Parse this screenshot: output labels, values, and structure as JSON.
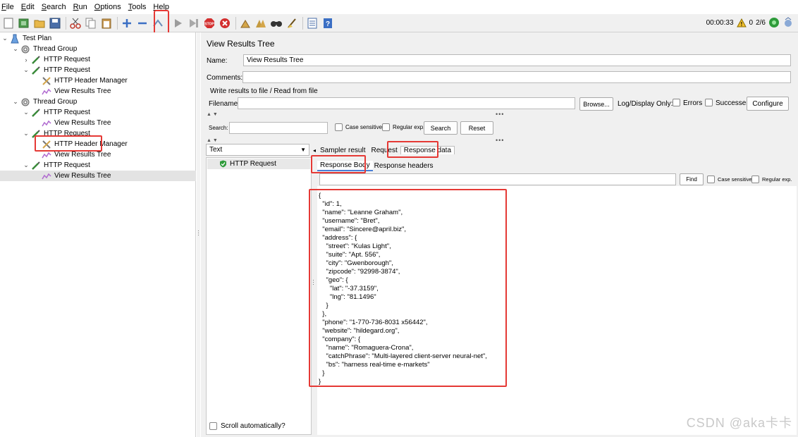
{
  "menu": [
    "File",
    "Edit",
    "Search",
    "Run",
    "Options",
    "Tools",
    "Help"
  ],
  "menu_underline": [
    "F",
    "E",
    "S",
    "R",
    "O",
    "T",
    "H"
  ],
  "status": {
    "timer": "00:00:33",
    "warnings": "0",
    "threads": "2/6"
  },
  "tree": [
    {
      "label": "Test Plan",
      "icon": "test-plan-icon",
      "indent": 0,
      "chev": "⌄"
    },
    {
      "label": "Thread Group",
      "icon": "gear-icon",
      "indent": 1,
      "chev": "⌄"
    },
    {
      "label": "HTTP Request",
      "icon": "pipette-icon",
      "indent": 2,
      "chev": "›"
    },
    {
      "label": "HTTP Request",
      "icon": "pipette-icon",
      "indent": 2,
      "chev": "⌄"
    },
    {
      "label": "HTTP Header Manager",
      "icon": "tools-icon",
      "indent": 3,
      "chev": ""
    },
    {
      "label": "View Results Tree",
      "icon": "chart-icon",
      "indent": 3,
      "chev": ""
    },
    {
      "label": "Thread Group",
      "icon": "gear-icon",
      "indent": 1,
      "chev": "⌄"
    },
    {
      "label": "HTTP Request",
      "icon": "pipette-icon",
      "indent": 2,
      "chev": "⌄"
    },
    {
      "label": "View Results Tree",
      "icon": "chart-icon",
      "indent": 3,
      "chev": ""
    },
    {
      "label": "HTTP Request",
      "icon": "pipette-icon",
      "indent": 2,
      "chev": "⌄"
    },
    {
      "label": "HTTP Header Manager",
      "icon": "tools-icon",
      "indent": 3,
      "chev": ""
    },
    {
      "label": "View Results Tree",
      "icon": "chart-icon",
      "indent": 3,
      "chev": ""
    },
    {
      "label": "HTTP Request",
      "icon": "pipette-icon",
      "indent": 2,
      "chev": "⌄"
    },
    {
      "label": "View Results Tree",
      "icon": "chart-icon",
      "indent": 3,
      "chev": "",
      "selected": true
    }
  ],
  "panel": {
    "title": "View Results Tree",
    "name_label": "Name:",
    "name_value": "View Results Tree",
    "comments_label": "Comments:",
    "write_results": "Write results to file / Read from file",
    "filename_label": "Filename",
    "browse": "Browse...",
    "log_display": "Log/Display Only:",
    "errors": "Errors",
    "successes": "Successes",
    "configure": "Configure",
    "search_label": "Search:",
    "case_sensitive": "Case sensitive",
    "regular_exp": "Regular exp.",
    "search_btn": "Search",
    "reset_btn": "Reset",
    "renderer": "Text",
    "result_item": "HTTP Request",
    "tabs": [
      "Sampler result",
      "Request",
      "Response data"
    ],
    "subtabs": [
      "Response Body",
      "Response headers"
    ],
    "find": "Find",
    "find_case": "Case sensitive",
    "find_regex": "Regular exp.",
    "scroll_auto": "Scroll automatically?"
  },
  "response_body": [
    "{",
    "  \"id\": 1,",
    "  \"name\": \"Leanne Graham\",",
    "  \"username\": \"Bret\",",
    "  \"email\": \"Sincere@april.biz\",",
    "  \"address\": {",
    "    \"street\": \"Kulas Light\",",
    "    \"suite\": \"Apt. 556\",",
    "    \"city\": \"Gwenborough\",",
    "    \"zipcode\": \"92998-3874\",",
    "    \"geo\": {",
    "      \"lat\": \"-37.3159\",",
    "      \"lng\": \"81.1496\"",
    "    }",
    "  },",
    "  \"phone\": \"1-770-736-8031 x56442\",",
    "  \"website\": \"hildegard.org\",",
    "  \"company\": {",
    "    \"name\": \"Romaguera-Crona\",",
    "    \"catchPhrase\": \"Multi-layered client-server neural-net\",",
    "    \"bs\": \"harness real-time e-markets\"",
    "  }",
    "}"
  ],
  "watermark": "CSDN @aka卡卡",
  "colors": {
    "highlight": "#e53935",
    "tab_underline": "#4a7fd6",
    "success": "#2e9b3a"
  }
}
